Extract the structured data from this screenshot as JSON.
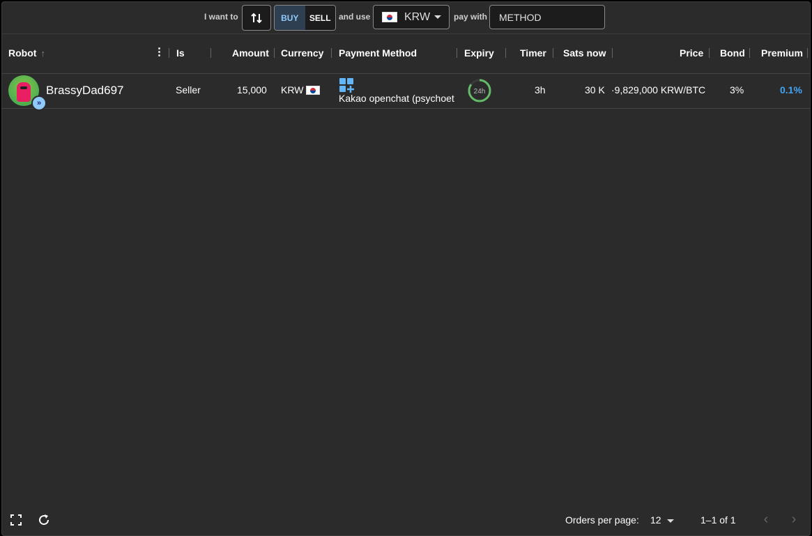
{
  "filter": {
    "i_want_to": "I want to",
    "buy": "BUY",
    "sell": "SELL",
    "and_use": "and use",
    "currency": "KRW",
    "pay_with": "pay with",
    "method_placeholder": "METHOD"
  },
  "columns": {
    "robot": "Robot",
    "is": "Is",
    "amount": "Amount",
    "currency": "Currency",
    "payment_method": "Payment Method",
    "expiry": "Expiry",
    "timer": "Timer",
    "sats_now": "Sats now",
    "price": "Price",
    "bond": "Bond",
    "premium": "Premium"
  },
  "orders": [
    {
      "robot": "BrassyDad697",
      "is": "Seller",
      "amount": "15,000",
      "currency": "KRW",
      "payment_method": "Kakao openchat (psychoet",
      "expiry": "24h",
      "expiry_fraction": 0.85,
      "timer": "3h",
      "sats_now": "30 K",
      "price": "·9,829,000 KRW/BTC",
      "bond": "3%",
      "premium": "0.1%"
    }
  ],
  "footer": {
    "orders_per_page_label": "Orders per page:",
    "orders_per_page": "12",
    "range": "1–1 of 1"
  },
  "colors": {
    "background": "#2b2b2b",
    "accent": "#90caf9",
    "premium": "#42a5f5",
    "expiry_ring": "#66bb6a"
  },
  "icons": {
    "swap": "swap-vert-icon",
    "fullscreen": "fullscreen-icon",
    "refresh": "refresh-icon",
    "payment_method": "add-box-grid-icon"
  }
}
